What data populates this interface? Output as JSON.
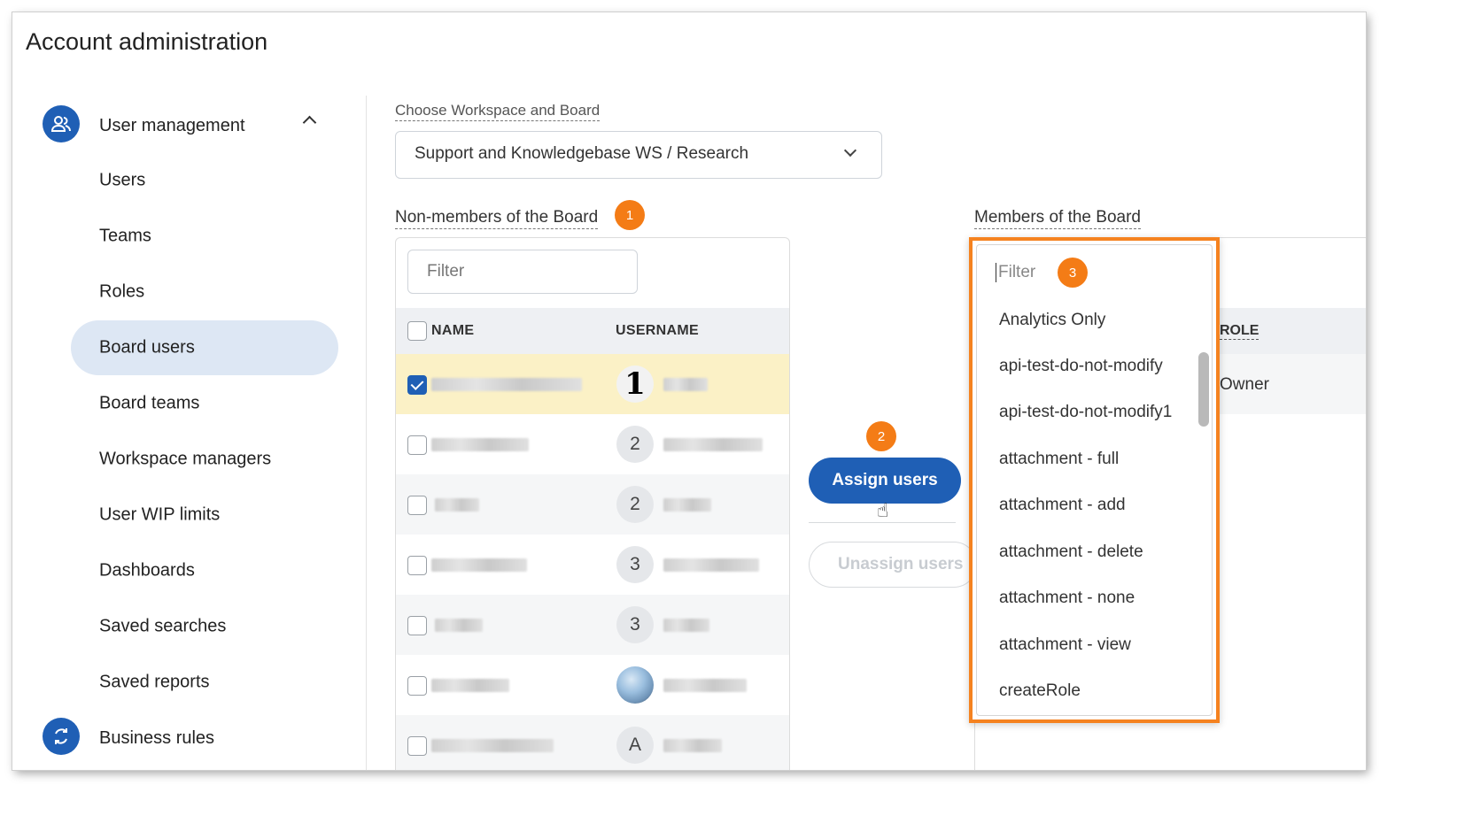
{
  "page": {
    "title": "Account administration"
  },
  "sidebar": {
    "sections": [
      {
        "label": "User management",
        "icon": "users-icon"
      },
      {
        "label": "Business rules",
        "icon": "refresh-icon"
      }
    ],
    "items": [
      {
        "label": "Users"
      },
      {
        "label": "Teams"
      },
      {
        "label": "Roles"
      },
      {
        "label": "Board users",
        "active": true
      },
      {
        "label": "Board teams"
      },
      {
        "label": "Workspace managers"
      },
      {
        "label": "User WIP limits"
      },
      {
        "label": "Dashboards"
      },
      {
        "label": "Saved searches"
      },
      {
        "label": "Saved reports"
      }
    ]
  },
  "workspace": {
    "label": "Choose Workspace and Board",
    "selected": "Support and Knowledgebase WS / Research"
  },
  "non_members": {
    "label": "Non-members of the Board",
    "badge": "1",
    "filter_placeholder": "Filter",
    "columns": {
      "name": "NAME",
      "username": "USERNAME"
    },
    "rows": [
      {
        "avatar": "1",
        "avatar_type": "logo",
        "checked": true
      },
      {
        "avatar": "2",
        "avatar_type": "initial",
        "checked": false
      },
      {
        "avatar": "2",
        "avatar_type": "initial",
        "checked": false
      },
      {
        "avatar": "3",
        "avatar_type": "initial",
        "checked": false
      },
      {
        "avatar": "3",
        "avatar_type": "initial",
        "checked": false
      },
      {
        "avatar": "",
        "avatar_type": "photo",
        "checked": false
      },
      {
        "avatar": "A",
        "avatar_type": "initial",
        "checked": false
      }
    ]
  },
  "actions": {
    "badge": "2",
    "assign_label": "Assign users",
    "unassign_label": "Unassign users"
  },
  "members": {
    "label": "Members of the Board",
    "role_header": "ROLE",
    "owner_role": "Owner"
  },
  "role_dropdown": {
    "badge": "3",
    "filter_placeholder": "Filter",
    "options": [
      "Analytics Only",
      "api-test-do-not-modify",
      "api-test-do-not-modify1",
      "attachment - full",
      "attachment - add",
      "attachment - delete",
      "attachment - none",
      "attachment - view",
      "createRole"
    ]
  },
  "colors": {
    "primary": "#1f5fb5",
    "highlight": "#f5821f",
    "selected_row": "#fbf1c6",
    "active_nav": "#dde7f4"
  }
}
